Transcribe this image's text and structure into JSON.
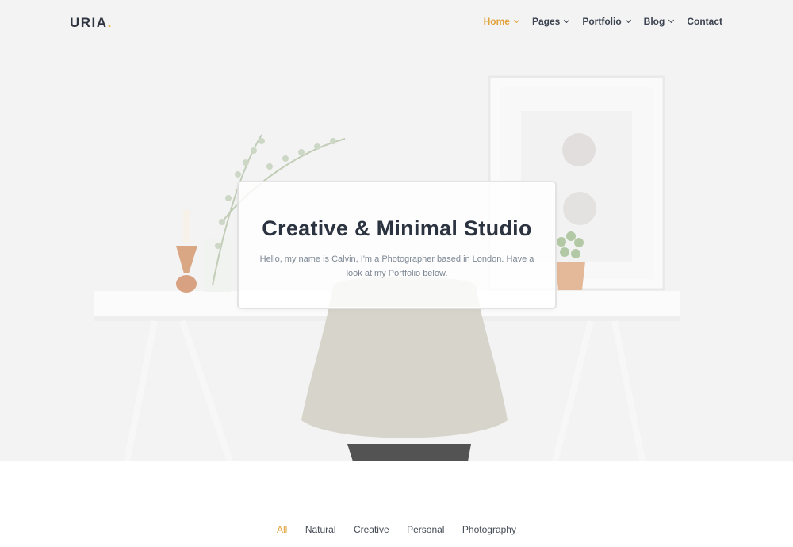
{
  "brand": {
    "name": "URIA",
    "dot": ".",
    "accent": "#e6b143"
  },
  "nav": {
    "items": [
      {
        "label": "Home",
        "dropdown": true,
        "active": true
      },
      {
        "label": "Pages",
        "dropdown": true,
        "active": false
      },
      {
        "label": "Portfolio",
        "dropdown": true,
        "active": false
      },
      {
        "label": "Blog",
        "dropdown": true,
        "active": false
      },
      {
        "label": "Contact",
        "dropdown": false,
        "active": false
      }
    ],
    "accent": "#e0a33c"
  },
  "hero": {
    "title": "Creative & Minimal Studio",
    "subtitle": "Hello, my name is Calvin, I'm a Photographer based in London. Have a look at my Portfolio below."
  },
  "filters": {
    "items": [
      "All",
      "Natural",
      "Creative",
      "Personal",
      "Photography"
    ],
    "active_index": 0
  }
}
